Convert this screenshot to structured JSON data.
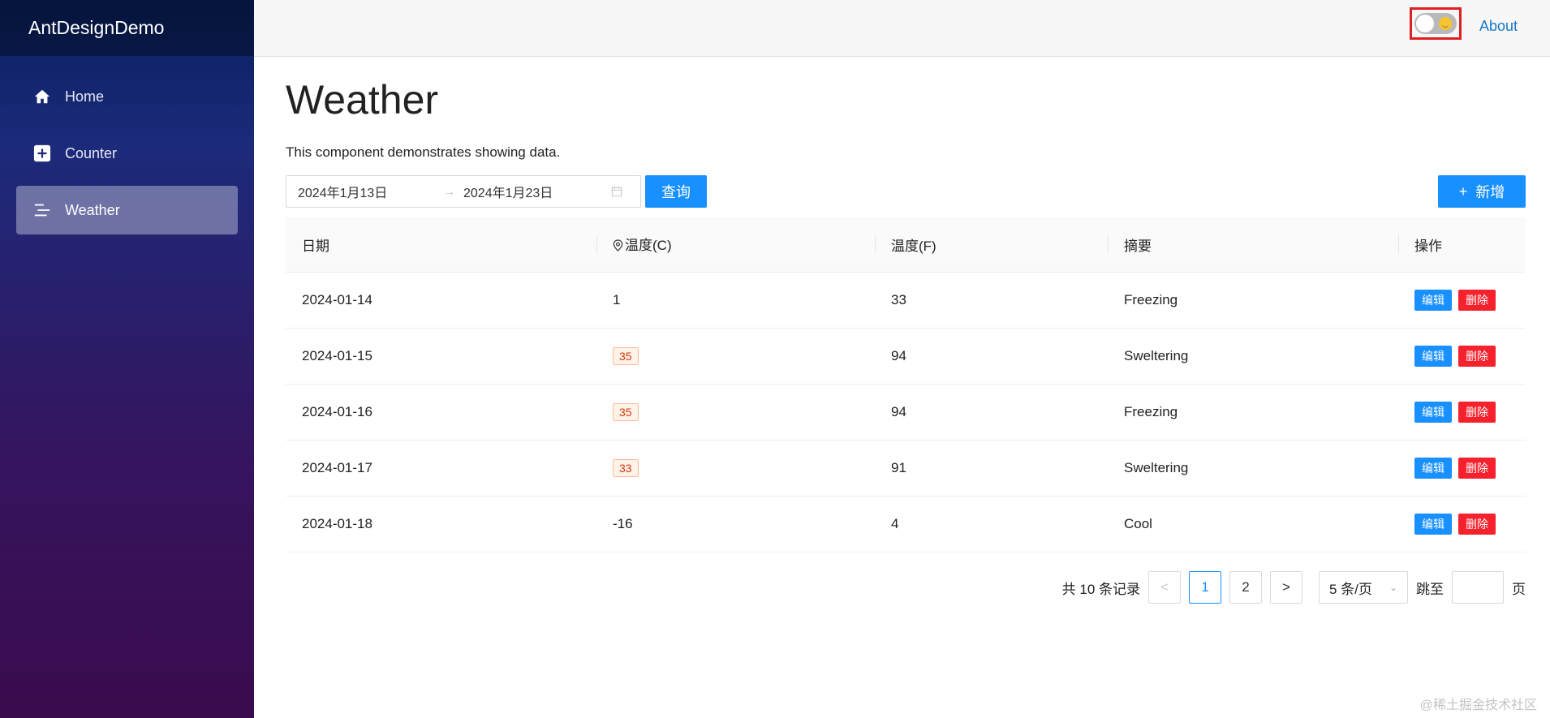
{
  "app": {
    "title": "AntDesignDemo"
  },
  "sidebar": {
    "items": [
      {
        "label": "Home",
        "icon": "home-icon",
        "active": false
      },
      {
        "label": "Counter",
        "icon": "plus-square-icon",
        "active": false
      },
      {
        "label": "Weather",
        "icon": "list-icon",
        "active": true
      }
    ]
  },
  "header": {
    "about_label": "About",
    "theme_toggle": {
      "on": false,
      "icon": "smile-emoji-icon"
    }
  },
  "page": {
    "title": "Weather",
    "intro": "This component demonstrates showing data."
  },
  "toolbar": {
    "start_date": "2024年1月13日",
    "range_separator": "→",
    "end_date": "2024年1月23日",
    "query_label": "查询",
    "add_label": "新增",
    "add_icon": "+"
  },
  "table": {
    "columns": [
      "日期",
      "温度(C)",
      "温度(F)",
      "摘要",
      "操作"
    ],
    "rows": [
      {
        "date": "2024-01-14",
        "temp_c": "1",
        "temp_c_tag": false,
        "temp_f": "33",
        "summary": "Freezing"
      },
      {
        "date": "2024-01-15",
        "temp_c": "35",
        "temp_c_tag": true,
        "temp_f": "94",
        "summary": "Sweltering"
      },
      {
        "date": "2024-01-16",
        "temp_c": "35",
        "temp_c_tag": true,
        "temp_f": "94",
        "summary": "Freezing"
      },
      {
        "date": "2024-01-17",
        "temp_c": "33",
        "temp_c_tag": true,
        "temp_f": "91",
        "summary": "Sweltering"
      },
      {
        "date": "2024-01-18",
        "temp_c": "-16",
        "temp_c_tag": false,
        "temp_f": "4",
        "summary": "Cool"
      }
    ],
    "edit_label": "编辑",
    "delete_label": "删除"
  },
  "pagination": {
    "total_text": "共 10 条记录",
    "prev_icon": "<",
    "next_icon": ">",
    "pages": [
      "1",
      "2"
    ],
    "current_page": "1",
    "page_size": "5 条/页",
    "jump_label": "跳至",
    "page_suffix": "页"
  },
  "watermark": "@稀土掘金技术社区",
  "colors": {
    "primary": "#1890ff",
    "danger": "#f5222d",
    "tag": "#d4380d"
  }
}
